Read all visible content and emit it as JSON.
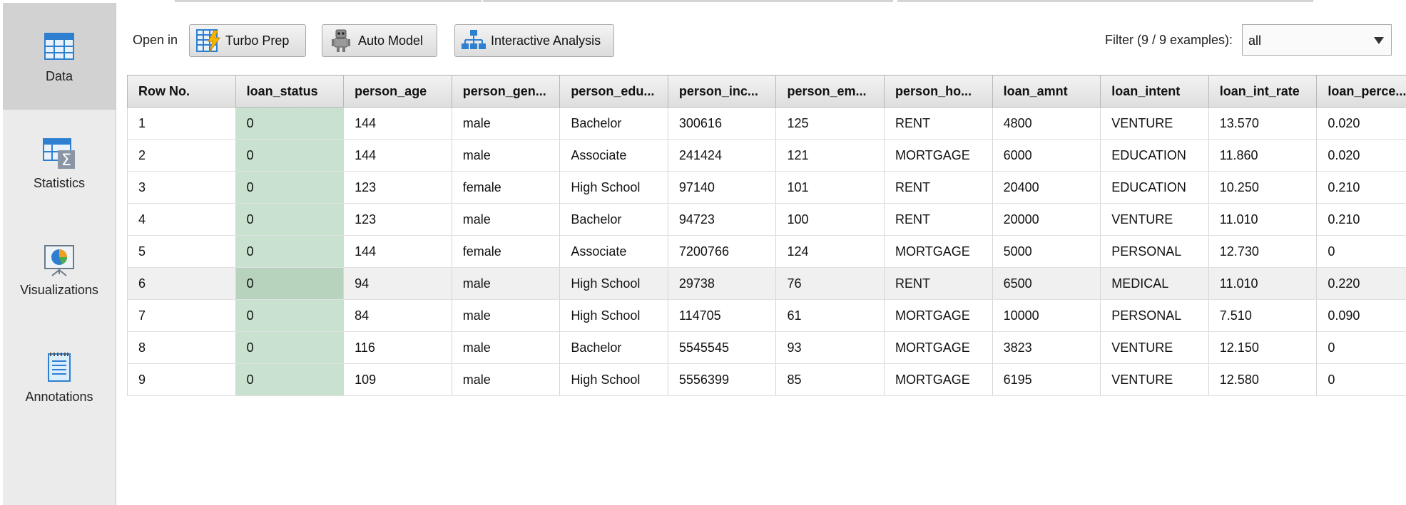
{
  "sidebar": {
    "items": [
      {
        "label": "Data",
        "icon": "table-icon",
        "active": true
      },
      {
        "label": "Statistics",
        "icon": "statistics-sigma-icon",
        "active": false
      },
      {
        "label": "Visualizations",
        "icon": "pie-chart-easel-icon",
        "active": false
      },
      {
        "label": "Annotations",
        "icon": "notepad-icon",
        "active": false
      }
    ]
  },
  "toolbar": {
    "open_in_label": "Open in",
    "buttons": [
      {
        "label": "Turbo Prep",
        "icon": "turbo-prep-icon"
      },
      {
        "label": "Auto Model",
        "icon": "robot-icon"
      },
      {
        "label": "Interactive Analysis",
        "icon": "hierarchy-icon"
      }
    ],
    "filter_label": "Filter (9 / 9 examples):",
    "filter_value": "all"
  },
  "table": {
    "columns": [
      "Row No.",
      "loan_status",
      "person_age",
      "person_gen...",
      "person_edu...",
      "person_inc...",
      "person_em...",
      "person_ho...",
      "loan_amnt",
      "loan_intent",
      "loan_int_rate",
      "loan_perce..."
    ],
    "rows": [
      [
        "1",
        "0",
        "144",
        "male",
        "Bachelor",
        "300616",
        "125",
        "RENT",
        "4800",
        "VENTURE",
        "13.570",
        "0.020"
      ],
      [
        "2",
        "0",
        "144",
        "male",
        "Associate",
        "241424",
        "121",
        "MORTGAGE",
        "6000",
        "EDUCATION",
        "11.860",
        "0.020"
      ],
      [
        "3",
        "0",
        "123",
        "female",
        "High School",
        "97140",
        "101",
        "RENT",
        "20400",
        "EDUCATION",
        "10.250",
        "0.210"
      ],
      [
        "4",
        "0",
        "123",
        "male",
        "Bachelor",
        "94723",
        "100",
        "RENT",
        "20000",
        "VENTURE",
        "11.010",
        "0.210"
      ],
      [
        "5",
        "0",
        "144",
        "female",
        "Associate",
        "7200766",
        "124",
        "MORTGAGE",
        "5000",
        "PERSONAL",
        "12.730",
        "0"
      ],
      [
        "6",
        "0",
        "94",
        "male",
        "High School",
        "29738",
        "76",
        "RENT",
        "6500",
        "MEDICAL",
        "11.010",
        "0.220"
      ],
      [
        "7",
        "0",
        "84",
        "male",
        "High School",
        "114705",
        "61",
        "MORTGAGE",
        "10000",
        "PERSONAL",
        "7.510",
        "0.090"
      ],
      [
        "8",
        "0",
        "116",
        "male",
        "Bachelor",
        "5545545",
        "93",
        "MORTGAGE",
        "3823",
        "VENTURE",
        "12.150",
        "0"
      ],
      [
        "9",
        "0",
        "109",
        "male",
        "High School",
        "5556399",
        "85",
        "MORTGAGE",
        "6195",
        "VENTURE",
        "12.580",
        "0"
      ]
    ],
    "highlighted_row": 6,
    "label_column_color": "#c9e2cf"
  }
}
